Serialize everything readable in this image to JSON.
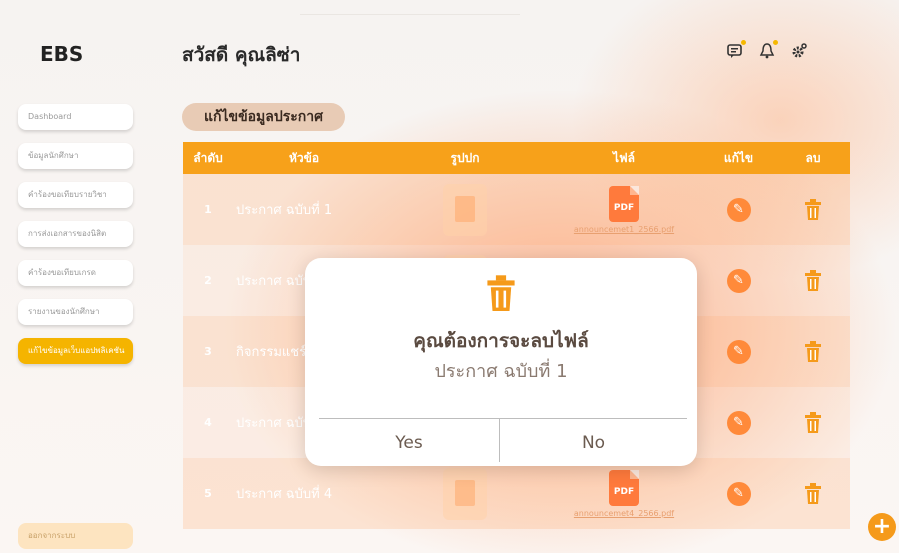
{
  "app": {
    "logo": "EBS",
    "greeting": "สวัสดี คุณลิซ่า"
  },
  "header_icons": [
    "chat-icon",
    "bell-icon",
    "gear-icon"
  ],
  "sidebar": {
    "items": [
      {
        "label": "Dashboard",
        "active": false
      },
      {
        "label": "ข้อมูลนักศึกษา",
        "active": false
      },
      {
        "label": "คำร้องขอเทียบรายวิชา",
        "active": false
      },
      {
        "label": "การส่งเอกสารของนิสิต",
        "active": false
      },
      {
        "label": "คำร้องขอเทียบเกรด",
        "active": false
      },
      {
        "label": "รายงานของนักศึกษา",
        "active": false
      },
      {
        "label": "แก้ไขข้อมูลเว็บแอปพลิเคชัน",
        "active": true
      }
    ],
    "logout_label": "ออกจากระบบ"
  },
  "section": {
    "title": "แก้ไขข้อมูลประกาศ"
  },
  "table": {
    "headers": {
      "no": "ลำดับ",
      "title": "หัวข้อ",
      "image": "รูปปก",
      "file": "ไฟล์",
      "edit": "แก้ไข",
      "delete": "ลบ"
    },
    "rows": [
      {
        "no": "1",
        "title": "ประกาศ ฉบับที่ 1",
        "file": "announcemet1_2566.pdf"
      },
      {
        "no": "2",
        "title": "ประกาศ ฉบับ",
        "file": ""
      },
      {
        "no": "3",
        "title": "กิจกรรมแชร์ป",
        "file": ""
      },
      {
        "no": "4",
        "title": "ประกาศ ฉบับ",
        "file": ""
      },
      {
        "no": "5",
        "title": "ประกาศ ฉบับที่ 4",
        "file": "announcemet4_2566.pdf"
      }
    ],
    "pdf_label": "PDF"
  },
  "modal": {
    "title": "คุณต้องการจะลบไฟล์",
    "subtitle": "ประกาศ ฉบับที่ 1",
    "yes_label": "Yes",
    "no_label": "No"
  },
  "fab_label": "+",
  "colors": {
    "accent": "#f7a11a",
    "active": "#f5b400",
    "delete": "#f59a1a",
    "edit": "#ff8a3a"
  }
}
